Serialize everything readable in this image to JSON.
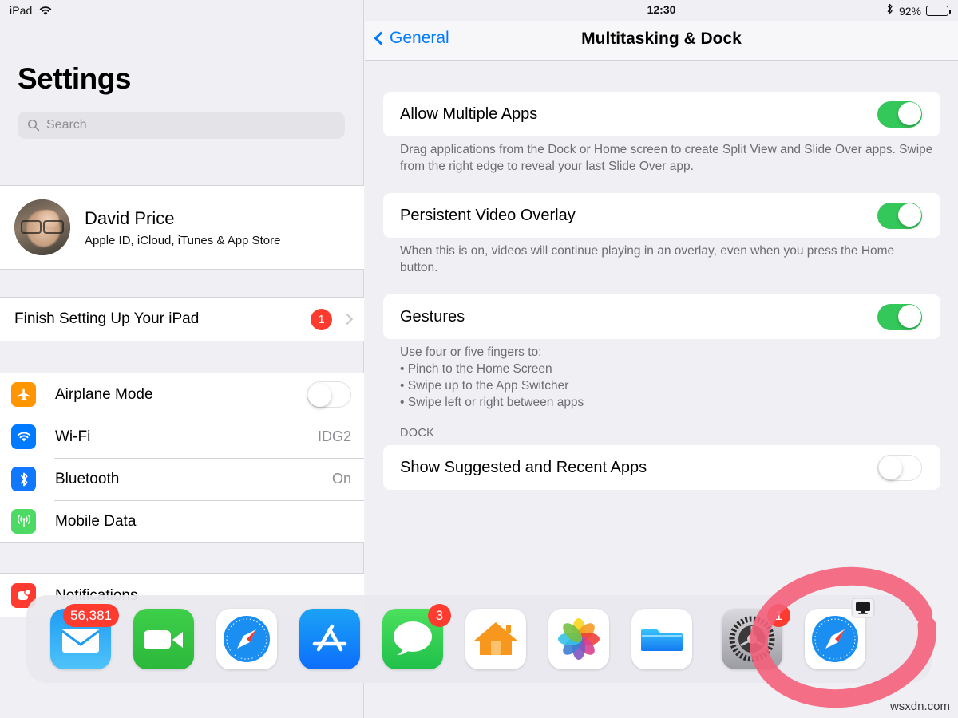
{
  "status_bar": {
    "device_label": "iPad",
    "wifi_icon": "wifi-icon",
    "time": "12:30",
    "bluetooth_icon": "bluetooth-icon",
    "battery_percent": "92%"
  },
  "sidebar": {
    "title": "Settings",
    "search": {
      "placeholder": "Search",
      "icon": "search-icon",
      "value": ""
    },
    "account": {
      "name": "David Price",
      "subtitle": "Apple ID, iCloud, iTunes & App Store",
      "avatar": "user-avatar"
    },
    "finish_setup": {
      "label": "Finish Setting Up Your iPad",
      "badge": "1",
      "chevron": "chevron-right-icon"
    },
    "connectivity": [
      {
        "label": "Airplane Mode",
        "icon": "airplane-icon",
        "icon_color": "#ff9500",
        "control": "toggle",
        "state": "off"
      },
      {
        "label": "Wi-Fi",
        "icon": "wifi-icon",
        "icon_color": "#007aff",
        "control": "value",
        "value": "IDG2"
      },
      {
        "label": "Bluetooth",
        "icon": "bluetooth-icon",
        "icon_color": "#1077ff",
        "control": "value",
        "value": "On"
      },
      {
        "label": "Mobile Data",
        "icon": "cellular-icon",
        "icon_color": "#4cd964",
        "control": "value",
        "value": ""
      }
    ],
    "notifications": {
      "label": "Notifications",
      "icon": "notifications-icon",
      "icon_color": "#ff3b30"
    }
  },
  "detail": {
    "back_label": "General",
    "title": "Multitasking & Dock",
    "rows": [
      {
        "label": "Allow Multiple Apps",
        "state": "on",
        "footnote": "Drag applications from the Dock or Home screen to create Split View and Slide Over apps. Swipe from the right edge to reveal your last Slide Over app."
      },
      {
        "label": "Persistent Video Overlay",
        "state": "on",
        "footnote": "When this is on, videos will continue playing in an overlay, even when you press the Home button."
      },
      {
        "label": "Gestures",
        "state": "on",
        "footnote": ""
      }
    ],
    "gestures_intro": "Use four or five fingers to:",
    "gestures_bullets": [
      "• Pinch to the Home Screen",
      "• Swipe up to the App Switcher",
      "• Swipe left or right between apps"
    ],
    "dock_section_header": "DOCK",
    "dock_row": {
      "label": "Show Suggested and Recent Apps",
      "state": "off"
    }
  },
  "dock": {
    "items": [
      {
        "name": "mail",
        "badge": "56,381"
      },
      {
        "name": "facetime",
        "badge": ""
      },
      {
        "name": "safari",
        "badge": ""
      },
      {
        "name": "app-store",
        "badge": ""
      },
      {
        "name": "messages",
        "badge": "3"
      },
      {
        "name": "home",
        "badge": ""
      },
      {
        "name": "photos",
        "badge": ""
      },
      {
        "name": "files",
        "badge": ""
      },
      {
        "name": "settings",
        "badge": "1"
      },
      {
        "name": "safari-recent",
        "badge": ""
      }
    ]
  },
  "annotation": {
    "shape": "red-circle-highlight",
    "color": "#f4607a"
  },
  "watermark": {
    "text": "wsxdn.com"
  },
  "colors": {
    "accent_blue": "#007aff",
    "toggle_green": "#34c759",
    "badge_red": "#ff3b30"
  }
}
